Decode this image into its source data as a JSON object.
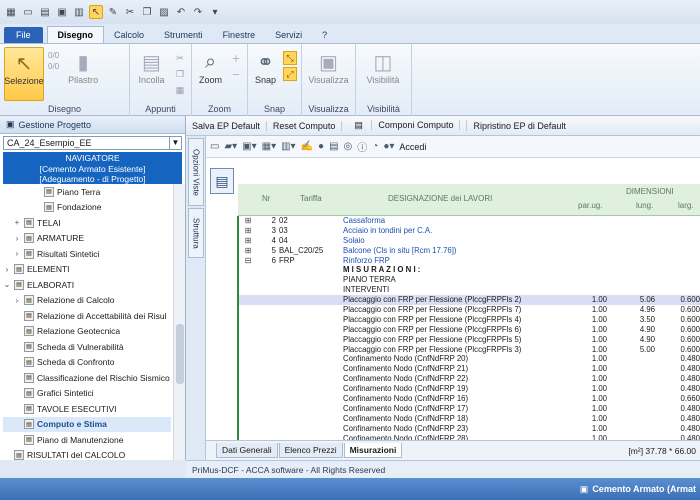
{
  "qat": {
    "icons": [
      "save-icon",
      "new-icon",
      "open-icon",
      "pointer-icon",
      "undo-icon",
      "redo-icon"
    ]
  },
  "tabs": {
    "file": "File",
    "items": [
      "Disegno",
      "Calcolo",
      "Strumenti",
      "Finestre",
      "Servizi",
      "?"
    ]
  },
  "ribbon": {
    "selezione": "Selezione",
    "count_top": "0/0",
    "count_bot": "0/0",
    "pilastro": "Pilastro",
    "incolla": "Incolla",
    "zoom": "Zoom",
    "snap": "Snap",
    "visualizza": "Visualizza",
    "visibilita": "Visibilità",
    "groups": {
      "disegno": "Disegno",
      "appunti": "Appunti",
      "zoom": "Zoom",
      "snap": "Snap",
      "visualizza": "Visualizza",
      "visibilita": "Visibilità"
    }
  },
  "panel": {
    "title": "Gestione Progetto",
    "combo": "CA_24_Esempio_EE",
    "navigator": [
      "NAVIGATORE",
      "[Cemento Armato Esistente]",
      "[Adeguamento - di Progetto]"
    ],
    "tree": [
      {
        "label": "Piano Terra",
        "ex": "",
        "indent": 3
      },
      {
        "label": "Fondazione",
        "ex": "",
        "indent": 3
      },
      {
        "label": "TELAI",
        "ex": "+",
        "indent": 1
      },
      {
        "label": "ARMATURE",
        "ex": "›",
        "indent": 1
      },
      {
        "label": "Risultati Sintetici",
        "ex": "›",
        "indent": 1
      },
      {
        "label": "ELEMENTI",
        "ex": "›",
        "indent": 0
      },
      {
        "label": "ELABORATI",
        "ex": "⌄",
        "indent": 0
      },
      {
        "label": "Relazione di Calcolo",
        "ex": "›",
        "indent": 1
      },
      {
        "label": "Relazione di Accettabilità dei Risul",
        "ex": "",
        "indent": 1
      },
      {
        "label": "Relazione Geotecnica",
        "ex": "",
        "indent": 1
      },
      {
        "label": "Scheda di Vulnerabilità",
        "ex": "",
        "indent": 1
      },
      {
        "label": "Scheda di Confronto",
        "ex": "",
        "indent": 1
      },
      {
        "label": "Classificazione del Rischio Sismico",
        "ex": "",
        "indent": 1
      },
      {
        "label": "Grafici Sintetici",
        "ex": "",
        "indent": 1
      },
      {
        "label": "TAVOLE ESECUTIVI",
        "ex": "",
        "indent": 1
      },
      {
        "label": "Computo e Stima",
        "ex": "",
        "indent": 1,
        "hl": true
      },
      {
        "label": "Piano di Manutenzione",
        "ex": "",
        "indent": 1
      },
      {
        "label": "RISULTATI del CALCOLO",
        "ex": "",
        "indent": 0
      },
      {
        "label": "DIAGNOSTICA",
        "ex": "›",
        "indent": 0
      }
    ]
  },
  "steps": [
    "Salva EP Default",
    "Reset Computo",
    "Componi Computo",
    "Ripristino EP di Default"
  ],
  "vtabs": [
    "Opzioni Viste",
    "Struttura"
  ],
  "toolbar": {
    "accedi": "Accedi"
  },
  "table": {
    "h_nr": "Nr",
    "h_tariffa": "Tariffa",
    "h_designazione": "DESIGNAZIONE dei LAVORI",
    "h_dimensioni": "DIMENSIONI",
    "h_parug": "par.ug.",
    "h_lung": "lung.",
    "h_larg": "larg.",
    "rows": [
      {
        "ex": "⊞",
        "nr": "2",
        "tar": "02",
        "des": "Cassaforma",
        "blue": true
      },
      {
        "ex": "⊞",
        "nr": "3",
        "tar": "03",
        "des": "Acciaio in tondini per C.A.",
        "blue": true
      },
      {
        "ex": "⊞",
        "nr": "4",
        "tar": "04",
        "des": "Solaio",
        "blue": true
      },
      {
        "ex": "⊞",
        "nr": "5",
        "tar": "BAL_C20/25",
        "des": "Balcone (Cls in situ [Rcm 17.76])",
        "blue": true
      },
      {
        "ex": "⊟",
        "nr": "6",
        "tar": "FRP",
        "des": "Rinforzo FRP",
        "blue": true
      },
      {
        "des": "M I S U R A Z I O N I :",
        "bold": true
      },
      {
        "des": "PIANO TERRA"
      },
      {
        "des": "INTERVENTI"
      },
      {
        "des": "Placcaggio con FRP per Flessione (PlccgFRPFls 2)",
        "p": "1.00",
        "l": "5.06",
        "w": "0.600",
        "band": true
      },
      {
        "des": "Placcaggio con FRP per Flessione (PlccgFRPFls 7)",
        "p": "1.00",
        "l": "4.96",
        "w": "0.600"
      },
      {
        "des": "Placcaggio con FRP per Flessione (PlccgFRPFls 4)",
        "p": "1.00",
        "l": "3.50",
        "w": "0.600"
      },
      {
        "des": "Placcaggio con FRP per Flessione (PlccgFRPFls 6)",
        "p": "1.00",
        "l": "4.90",
        "w": "0.600"
      },
      {
        "des": "Placcaggio con FRP per Flessione (PlccgFRPFls 5)",
        "p": "1.00",
        "l": "4.90",
        "w": "0.600"
      },
      {
        "des": "Placcaggio con FRP per Flessione (PlccgFRPFls 3)",
        "p": "1.00",
        "l": "5.00",
        "w": "0.600"
      },
      {
        "des": "Confinamento Nodo (CnfNdFRP 20)",
        "p": "1.00",
        "w": "0.480"
      },
      {
        "des": "Confinamento Nodo (CnfNdFRP 21)",
        "p": "1.00",
        "w": "0.480"
      },
      {
        "des": "Confinamento Nodo (CnfNdFRP 22)",
        "p": "1.00",
        "w": "0.480"
      },
      {
        "des": "Confinamento Nodo (CnfNdFRP 19)",
        "p": "1.00",
        "w": "0.480"
      },
      {
        "des": "Confinamento Nodo (CnfNdFRP 16)",
        "p": "1.00",
        "w": "0.660"
      },
      {
        "des": "Confinamento Nodo (CnfNdFRP 17)",
        "p": "1.00",
        "w": "0.480"
      },
      {
        "des": "Confinamento Nodo (CnfNdFRP 18)",
        "p": "1.00",
        "w": "0.480"
      },
      {
        "des": "Confinamento Nodo (CnfNdFRP 23)",
        "p": "1.00",
        "w": "0.480"
      },
      {
        "des": "Confinamento Nodo (CnfNdFRP 28)",
        "p": "1.00",
        "w": "0.480"
      }
    ]
  },
  "bottom_tabs": [
    "Dati Generali",
    "Elenco Prezzi",
    "Misurazioni"
  ],
  "bottom_value": "[m²] 37.78 * 66.00",
  "footer": "PriMus-DCF - ACCA software - All Rights Reserved",
  "status": "Cemento Armato (Armat"
}
